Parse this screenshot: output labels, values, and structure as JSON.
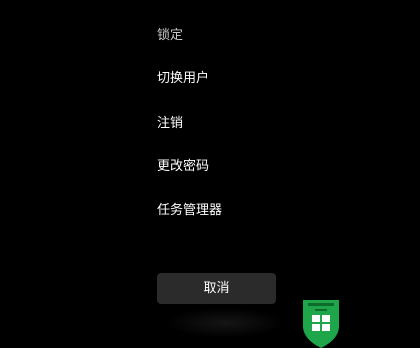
{
  "menu": {
    "items": [
      {
        "label": "锁定"
      },
      {
        "label": "切换用户"
      },
      {
        "label": "注销"
      },
      {
        "label": "更改密码"
      },
      {
        "label": "任务管理器"
      }
    ]
  },
  "cancel": {
    "label": "取消"
  },
  "colors": {
    "background": "#000000",
    "button": "#2b2b2b",
    "badge": "#1fa64a"
  },
  "icons": {
    "badge": "green-shield-windows-icon"
  }
}
